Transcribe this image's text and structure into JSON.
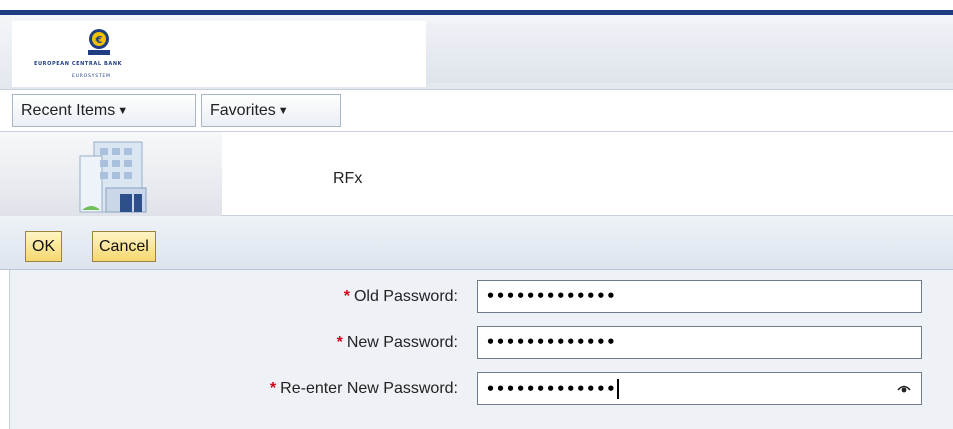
{
  "header": {
    "logo_text": "EUROPEAN CENTRAL BANK",
    "logo_subtext": "EUROSYSTEM",
    "logo_icon": "ecb-euro-logo-icon"
  },
  "menu": {
    "recent_items": "Recent Items",
    "favorites": "Favorites",
    "caret_icon": "caret-down-icon"
  },
  "banner": {
    "icon": "building-icon",
    "title": "RFx"
  },
  "toolbar": {
    "ok_label": "OK",
    "cancel_label": "Cancel"
  },
  "form": {
    "required_marker": "*",
    "old_password_label": "Old Password:",
    "old_password_value": "•••••••••••••",
    "new_password_label": "New Password:",
    "new_password_value": "•••••••••••••",
    "reenter_password_label": "Re-enter New Password:",
    "reenter_password_value": "•••••••••••••",
    "reveal_icon": "eye-icon"
  },
  "colors": {
    "brand_blue": "#1f3d82",
    "button_yellow": "#f6d870",
    "required_red": "#d0021b"
  }
}
